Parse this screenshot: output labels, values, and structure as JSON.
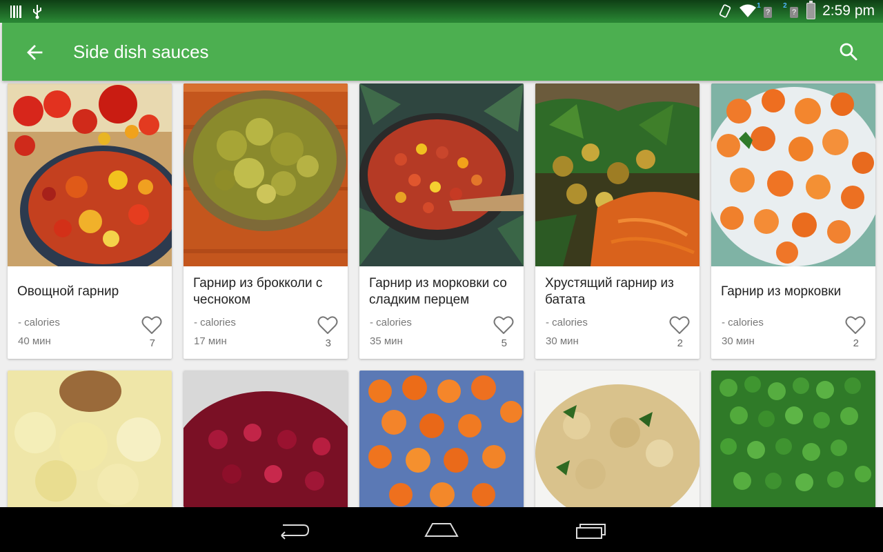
{
  "status_bar": {
    "time": "2:59 pm",
    "icons": [
      "barcode-icon",
      "usb-icon",
      "rotate-icon",
      "wifi-icon",
      "sim-1-icon",
      "sim-2-icon",
      "battery-icon"
    ],
    "sim1_label": "1",
    "sim2_label": "2"
  },
  "app_bar": {
    "title": "Side dish sauces",
    "back_icon": "arrow-back-icon",
    "search_icon": "search-icon",
    "color": "#4caf50"
  },
  "recipes": [
    {
      "title": "Овощной гарнир",
      "calories": "- calories",
      "time": "40 мин",
      "likes": "7"
    },
    {
      "title": "Гарнир из брокколи с чесноком",
      "calories": "- calories",
      "time": "17 мин",
      "likes": "3"
    },
    {
      "title": "Гарнир из морковки со сладким перцем",
      "calories": "- calories",
      "time": "35 мин",
      "likes": "5"
    },
    {
      "title": "Хрустящий гарнир из батата",
      "calories": "- calories",
      "time": "30 мин",
      "likes": "2"
    },
    {
      "title": "Гарнир из морковки",
      "calories": "- calories",
      "time": "30 мин",
      "likes": "2"
    }
  ],
  "navigation": {
    "back": "nav-back-icon",
    "home": "nav-home-icon",
    "recents": "nav-recents-icon"
  }
}
